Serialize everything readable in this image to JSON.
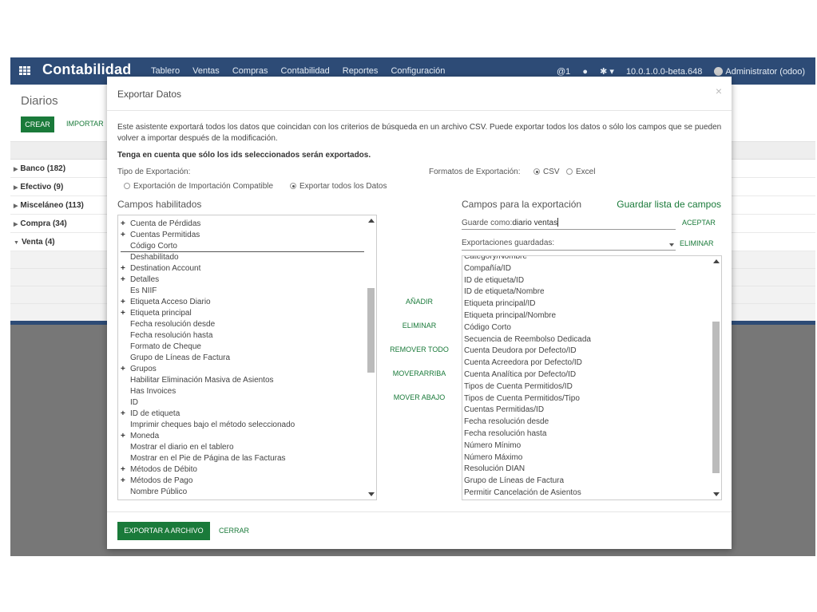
{
  "topbar": {
    "app_name": "Contabilidad",
    "menu": [
      "Tablero",
      "Ventas",
      "Compras",
      "Contabilidad",
      "Reportes",
      "Configuración"
    ],
    "mentions": "@1",
    "debug": "✱ ▾",
    "version": "10.0.1.0.0-beta.648",
    "user": "Administrator (odoo)"
  },
  "control_panel": {
    "title": "Diarios",
    "create_label": "CREAR",
    "import_label": "IMPORTAR"
  },
  "list": {
    "groups": [
      {
        "label": "Banco (182)",
        "expanded": false
      },
      {
        "label": "Efectivo (9)",
        "expanded": false
      },
      {
        "label": "Misceláneo (113)",
        "expanded": false
      },
      {
        "label": "Compra (34)",
        "expanded": false
      },
      {
        "label": "Venta (4)",
        "expanded": true
      }
    ]
  },
  "modal": {
    "title": "Exportar Datos",
    "close": "×",
    "intro": "Este asistente exportará todos los datos que coincidan con los criterios de búsqueda en un archivo CSV. Puede exportar todos los datos o sólo los campos que se pueden volver a importar después de la modificación.",
    "note": "Tenga en cuenta que sólo los ids seleccionados serán exportados.",
    "export_type_label": "Tipo de Exportación:",
    "export_type_options": [
      {
        "label": "Exportación de Importación Compatible",
        "checked": false
      },
      {
        "label": "Exportar todos los Datos",
        "checked": true
      }
    ],
    "format_label": "Formatos de Exportación:",
    "format_options": [
      {
        "label": "CSV",
        "checked": true
      },
      {
        "label": "Excel",
        "checked": false
      }
    ],
    "available_heading": "Campos habilitados",
    "export_heading": "Campos para la exportación",
    "save_list_label": "Guardar lista de campos",
    "available_fields": [
      {
        "label": "Cuenta de Pérdidas",
        "expandable": true
      },
      {
        "label": "Cuentas Permitidas",
        "expandable": true
      },
      {
        "label": "Código Corto",
        "expandable": false,
        "selected": true
      },
      {
        "label": "Deshabilitado",
        "expandable": false
      },
      {
        "label": "Destination Account",
        "expandable": true
      },
      {
        "label": "Detalles",
        "expandable": true
      },
      {
        "label": "Es NIIF",
        "expandable": false
      },
      {
        "label": "Etiqueta Acceso Diario",
        "expandable": true
      },
      {
        "label": "Etiqueta principal",
        "expandable": true
      },
      {
        "label": "Fecha resolución desde",
        "expandable": false
      },
      {
        "label": "Fecha resolución hasta",
        "expandable": false
      },
      {
        "label": "Formato de Cheque",
        "expandable": false
      },
      {
        "label": "Grupo de Líneas de Factura",
        "expandable": false
      },
      {
        "label": "Grupos",
        "expandable": true
      },
      {
        "label": "Habilitar Eliminación Masiva de Asientos",
        "expandable": false
      },
      {
        "label": "Has Invoices",
        "expandable": false
      },
      {
        "label": "ID",
        "expandable": false
      },
      {
        "label": "ID de etiqueta",
        "expandable": true
      },
      {
        "label": "Imprimir cheques bajo el método seleccionado",
        "expandable": false
      },
      {
        "label": "Moneda",
        "expandable": true
      },
      {
        "label": "Mostrar el diario en el tablero",
        "expandable": false
      },
      {
        "label": "Mostrar en el Pie de Página de las Facturas",
        "expandable": false
      },
      {
        "label": "Métodos de Débito",
        "expandable": true
      },
      {
        "label": "Métodos de Pago",
        "expandable": true
      },
      {
        "label": "Nombre Público",
        "expandable": false
      }
    ],
    "actions": [
      "AÑADIR",
      "ELIMINAR",
      "REMOVER TODO",
      "MOVERARRIBA",
      "MOVER ABAJO"
    ],
    "save_as_label": "Guarde como:",
    "save_as_value": "diario ventas",
    "accept_label": "ACEPTAR",
    "saved_exports_label": "Exportaciones guardadas:",
    "delete_label": "ELIMINAR",
    "export_fields": [
      "Category/Nombre",
      "Compañía/ID",
      "ID de etiqueta/ID",
      "ID de etiqueta/Nombre",
      "Etiqueta principal/ID",
      "Etiqueta principal/Nombre",
      "Código Corto",
      "Secuencia de Reembolso Dedicada",
      "Cuenta Deudora por Defecto/ID",
      "Cuenta Acreedora por Defecto/ID",
      "Cuenta Analítica por Defecto/ID",
      "Tipos de Cuenta Permitidos/ID",
      "Tipos de Cuenta Permitidos/Tipo",
      "Cuentas Permitidas/ID",
      "Fecha resolución desde",
      "Fecha resolución hasta",
      "Número Mínimo",
      "Número Máximo",
      "Resolución DIAN",
      "Grupo de Líneas de Factura",
      "Permitir Cancelación de Asientos"
    ],
    "export_button": "EXPORTAR A ARCHIVO",
    "close_button": "CERRAR"
  }
}
